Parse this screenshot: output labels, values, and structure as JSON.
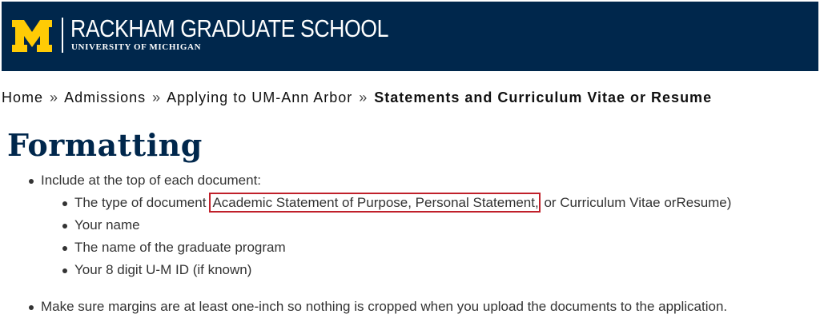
{
  "header": {
    "logo_letter": "M",
    "school_name": "RACKHAM GRADUATE SCHOOL",
    "university_name": "UNIVERSITY OF MICHIGAN",
    "background_color": "#00274c",
    "logo_color": "#ffcb05"
  },
  "breadcrumb": {
    "items": [
      "Home",
      "Admissions",
      "Applying to UM-Ann Arbor"
    ],
    "separator": "»",
    "current": "Statements and Curriculum Vitae or Resume"
  },
  "main": {
    "title": "Formatting",
    "list": {
      "item1": "Include at the top of each document:",
      "sub_item1_prefix": "The type of document",
      "sub_item1_highlight": "Academic Statement of Purpose, Personal Statement,",
      "sub_item1_suffix": " or Curriculum Vitae orResume)",
      "sub_item2": "Your name",
      "sub_item3": "The name of the graduate program",
      "sub_item4": "Your 8 digit U-M ID (if known)",
      "item2": "Make sure margins are at least one-inch so nothing is cropped when you upload the documents to the application."
    },
    "highlight_color": "#c0202a"
  }
}
